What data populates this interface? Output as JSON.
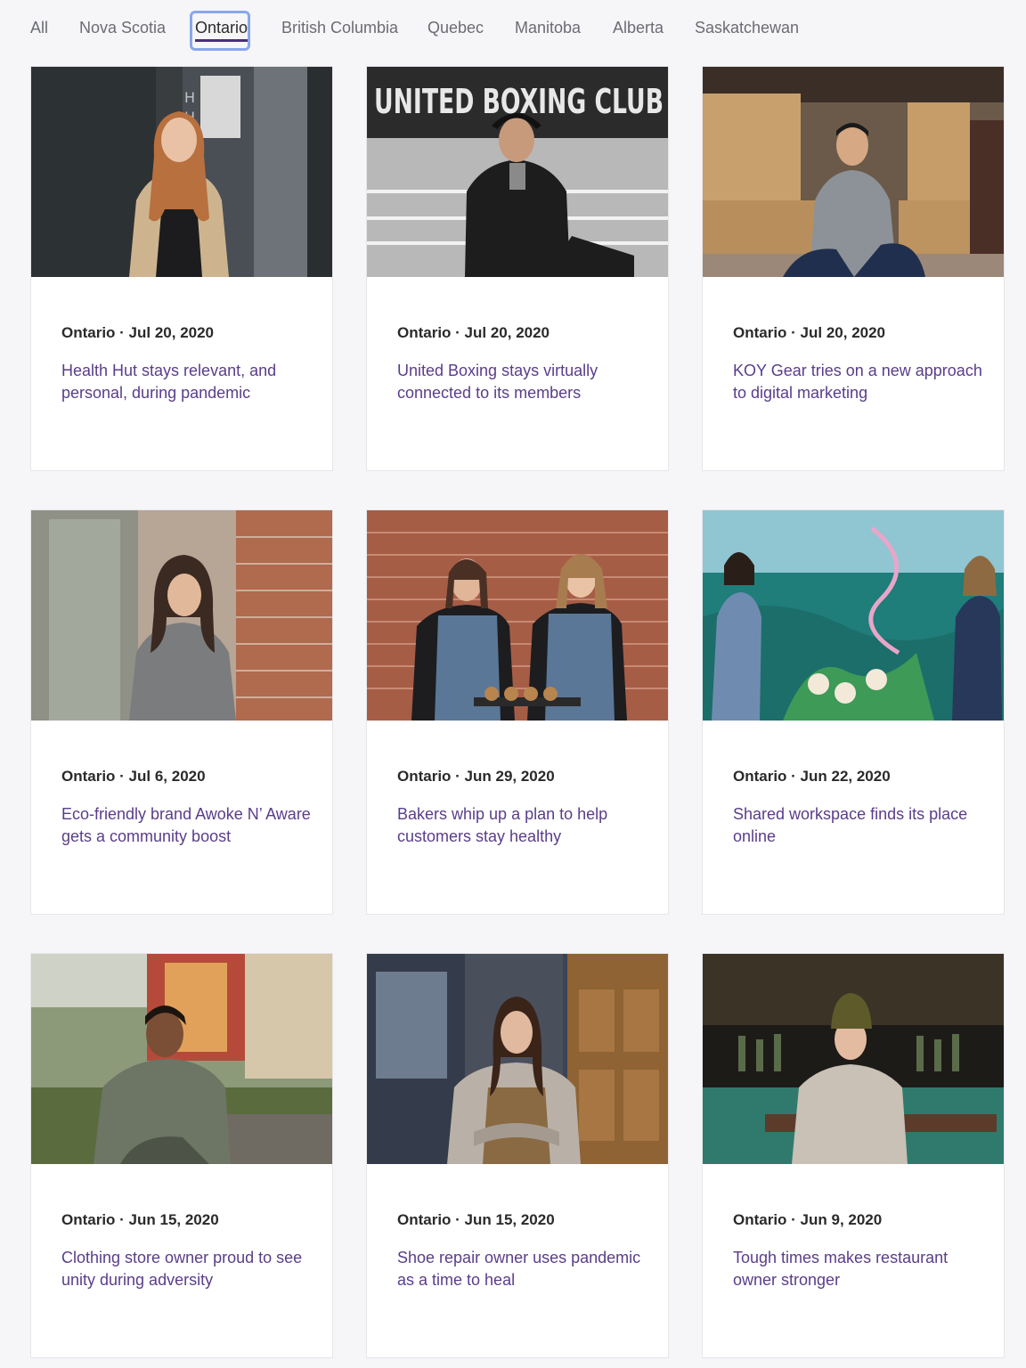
{
  "filters": {
    "tabs": [
      {
        "label": "All"
      },
      {
        "label": "Nova Scotia"
      },
      {
        "label": "Ontario",
        "active": true
      },
      {
        "label": "British Columbia"
      },
      {
        "label": "Quebec"
      },
      {
        "label": "Manitoba"
      },
      {
        "label": "Alberta"
      },
      {
        "label": "Saskatchewan"
      }
    ]
  },
  "stories": [
    {
      "region": "Ontario",
      "date": "Jul 20, 2020",
      "meta": "Ontario · Jul 20, 2020",
      "title": "Health Hut stays relevant, and personal, during pandemic",
      "image": "woman-in-storefront-photo"
    },
    {
      "region": "Ontario",
      "date": "Jul 20, 2020",
      "meta": "Ontario · Jul 20, 2020",
      "title": "United Boxing stays virtually connected to its members",
      "image": "boxer-in-ring-photo",
      "photo_sign": "UNITED BOXING CLUB"
    },
    {
      "region": "Ontario",
      "date": "Jul 20, 2020",
      "meta": "Ontario · Jul 20, 2020",
      "title": "KOY Gear tries on a new approach to digital marketing",
      "image": "man-with-boxes-photo"
    },
    {
      "region": "Ontario",
      "date": "Jul 6, 2020",
      "meta": "Ontario · Jul 6, 2020",
      "title": "Eco-friendly brand Awoke N’ Aware gets a community boost",
      "image": "woman-by-brick-wall-photo"
    },
    {
      "region": "Ontario",
      "date": "Jun 29, 2020",
      "meta": "Ontario · Jun 29, 2020",
      "title": "Bakers whip up a plan to help customers stay healthy",
      "image": "two-bakers-photo"
    },
    {
      "region": "Ontario",
      "date": "Jun 22, 2020",
      "meta": "Ontario · Jun 22, 2020",
      "title": "Shared workspace finds its place online",
      "image": "women-by-mural-photo"
    },
    {
      "region": "Ontario",
      "date": "Jun 15, 2020",
      "meta": "Ontario · Jun 15, 2020",
      "title": "Clothing store owner proud to see unity during adversity",
      "image": "person-on-porch-photo"
    },
    {
      "region": "Ontario",
      "date": "Jun 15, 2020",
      "meta": "Ontario · Jun 15, 2020",
      "title": "Shoe repair owner uses pandemic as a time to heal",
      "image": "woman-by-shop-door-photo"
    },
    {
      "region": "Ontario",
      "date": "Jun 9, 2020",
      "meta": "Ontario · Jun 9, 2020",
      "title": "Tough times makes restaurant owner stronger",
      "image": "man-outside-restaurant-photo"
    }
  ],
  "colors": {
    "page_bg": "#f6f6f9",
    "title_link": "#5a3d8a",
    "active_underline": "#4a2f7a",
    "focus_ring": "#8aa6ee"
  }
}
